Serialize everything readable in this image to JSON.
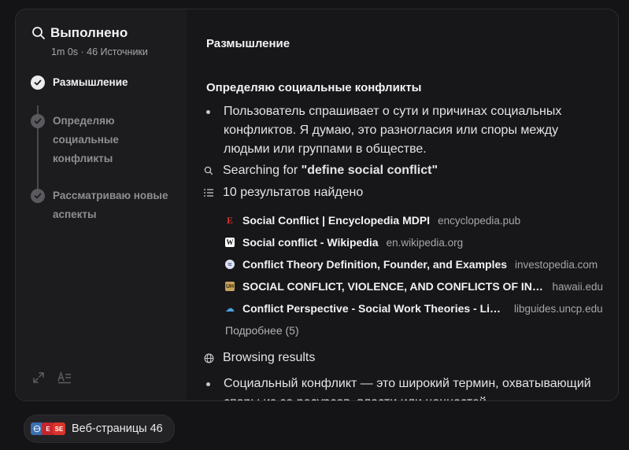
{
  "header": {
    "title": "Выполнено",
    "duration": "1m 0s",
    "sources": "46 Источники",
    "search_icon": "search-icon"
  },
  "steps": [
    {
      "label": "Размышление",
      "state": "active"
    },
    {
      "label": "Определяю социальные конфликты",
      "state": "done"
    },
    {
      "label": "Рассматриваю новые аспекты",
      "state": "done"
    }
  ],
  "content": {
    "heading": "Размышление",
    "subheading": "Определяю социальные конфликты",
    "paragraph1": "Пользователь спрашивает о сути и причинах социальных конфликтов. Я думаю, это разногласия или споры между людьми или группами в обществе.",
    "search_prefix": "Searching for ",
    "search_query": "\"define social conflict\"",
    "results_count": "10 результатов найдено",
    "results": [
      {
        "title": "Social Conflict | Encyclopedia MDPI",
        "domain": "encyclopedia.pub",
        "favicon": "E",
        "color": "#d9342b"
      },
      {
        "title": "Social conflict - Wikipedia",
        "domain": "en.wikipedia.org",
        "favicon": "W",
        "color": "#ffffff"
      },
      {
        "title": "Conflict Theory Definition, Founder, and Examples",
        "domain": "investopedia.com",
        "favicon": "≈",
        "color": "#2c3e8f"
      },
      {
        "title": "SOCIAL CONFLICT, VIOLENCE, AND CONFLICTS OF INT…",
        "domain": "hawaii.edu",
        "favicon": "UH",
        "color": "#c9a45c"
      },
      {
        "title": "Conflict Perspective - Social Work Theories - Lib…",
        "domain": "libguides.uncp.edu",
        "favicon": "☁",
        "color": "#4aa3df"
      }
    ],
    "more": "Подробнее (5)",
    "browsing": "Browsing results",
    "paragraph2": "Социальный конфликт — это широкий термин, охватывающий споры из-за ресурсов, власти или ценностей"
  },
  "chip": {
    "label": "Веб-страницы 46"
  }
}
